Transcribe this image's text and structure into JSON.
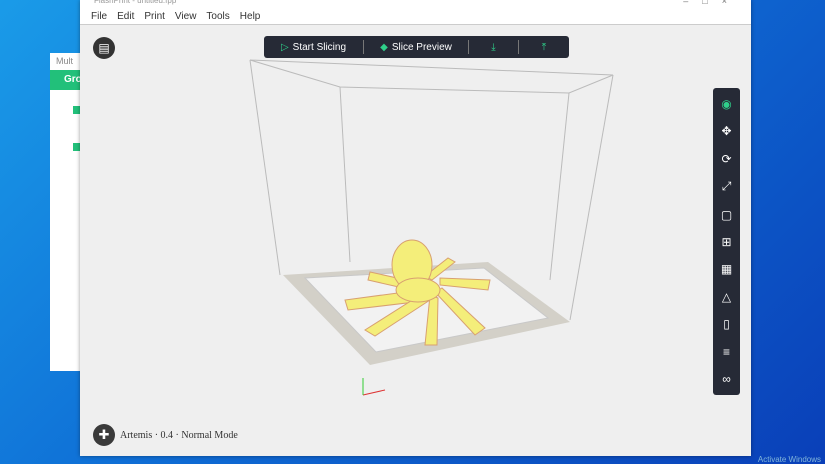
{
  "bg_window": {
    "title": "Mult",
    "header": "Group"
  },
  "window": {
    "title": "FlashPrint - untitled.fpp*",
    "controls": [
      "–",
      "□",
      "×"
    ]
  },
  "menu": [
    "File",
    "Edit",
    "Print",
    "View",
    "Tools",
    "Help"
  ],
  "toolbar": {
    "start_slicing": "Start Slicing",
    "slice_preview": "Slice Preview"
  },
  "side_tools": [
    "view",
    "move",
    "rotate",
    "scale",
    "cut",
    "add",
    "supports",
    "leveling",
    "printer",
    "settings",
    "link"
  ],
  "status": {
    "text": "Artemis · 0.4 · Normal Mode"
  },
  "desktop": {
    "watermark": "Activate Windows"
  },
  "colors": {
    "accent": "#2fd08a",
    "model": "#f4ee7a",
    "toolbar": "#262a36"
  }
}
